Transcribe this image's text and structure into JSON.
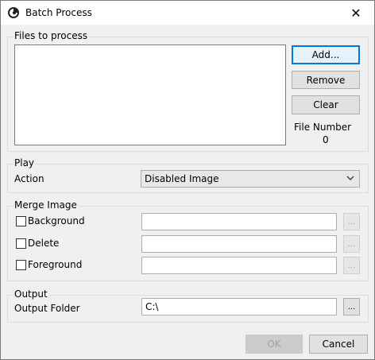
{
  "window": {
    "title": "Batch Process",
    "close_glyph": "✕"
  },
  "files_group": {
    "label": "Files to process",
    "add_label": "Add...",
    "remove_label": "Remove",
    "clear_label": "Clear",
    "file_number_label": "File Number",
    "file_number_value": "0"
  },
  "play_group": {
    "label": "Play",
    "action_label": "Action",
    "action_value": "Disabled Image"
  },
  "merge_group": {
    "label": "Merge Image",
    "background_label": "Background",
    "delete_label": "Delete",
    "foreground_label": "Foreground",
    "browse_glyph": "..."
  },
  "output_group": {
    "label": "Output",
    "folder_label": "Output Folder",
    "folder_value": "C:\\",
    "browse_glyph": "..."
  },
  "footer": {
    "ok_label": "OK",
    "cancel_label": "Cancel"
  }
}
